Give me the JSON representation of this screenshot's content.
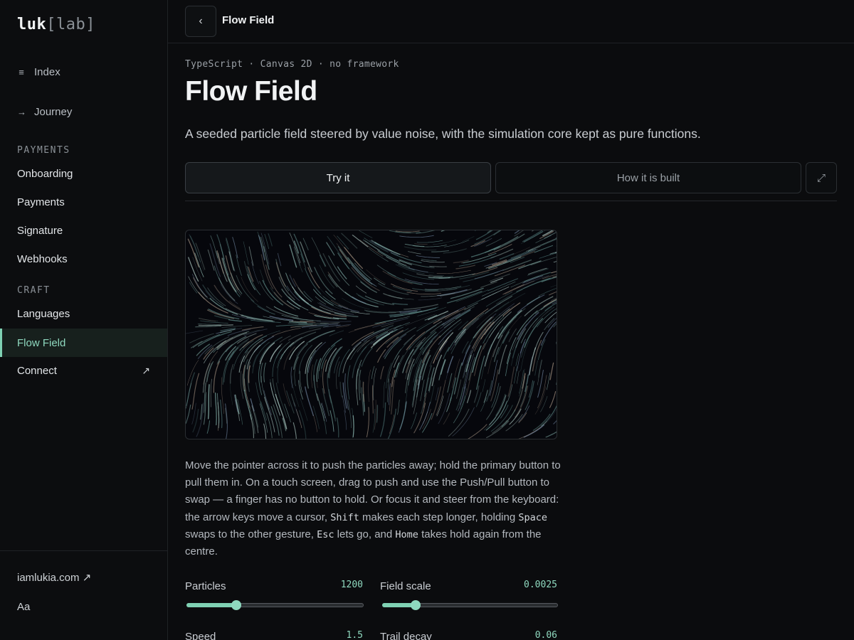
{
  "brand": {
    "name": "luk",
    "bracket_open": "[",
    "sub": "lab",
    "bracket_close": "]"
  },
  "sidebar": {
    "top": [
      {
        "icon": "≡",
        "label": "Index"
      },
      {
        "icon": "→",
        "label": "Journey"
      }
    ],
    "sections": [
      {
        "title": "PAYMENTS",
        "items": [
          "Onboarding",
          "Payments",
          "Signature",
          "Webhooks"
        ]
      },
      {
        "title": "CRAFT",
        "items": [
          "Languages",
          "Flow Field",
          "Connect"
        ]
      }
    ],
    "active_item": "Flow Field",
    "external_arrow": "↗",
    "footer": {
      "site": "iamlukia.com ↗",
      "type_toggle": "Aa"
    }
  },
  "topbar": {
    "back": "‹",
    "title": "Flow Field"
  },
  "page": {
    "meta": "TypeScript · Canvas 2D · no framework",
    "title": "Flow Field",
    "lede": "A seeded particle field steered by value noise, with the simulation core kept as pure functions.",
    "tabs": [
      "Try it",
      "How it is built"
    ],
    "active_tab": "Try it",
    "expand_icon": "⤢"
  },
  "description": {
    "parts": [
      "Move the pointer across it to push the particles away; hold the primary button to pull them in. On a touch screen, drag to push and use the Push/Pull button to swap — a finger has no button to hold. Or focus it and steer from the keyboard: the arrow keys move a cursor, ",
      "Shift",
      " makes each step longer, holding ",
      "Space",
      " swaps to the other gesture, ",
      "Esc",
      " lets go, and ",
      "Home",
      " takes hold again from the centre."
    ]
  },
  "controls": [
    {
      "label": "Particles",
      "value": "1200",
      "level": 0.28
    },
    {
      "label": "Field scale",
      "value": "0.0025",
      "level": 0.19
    },
    {
      "label": "Speed",
      "value": "1.5"
    },
    {
      "label": "Trail decay",
      "value": "0.06"
    }
  ],
  "colors": {
    "accent": "#7fd1b3",
    "background": "#0b0c0e",
    "canvas_bg": "#06070c"
  }
}
